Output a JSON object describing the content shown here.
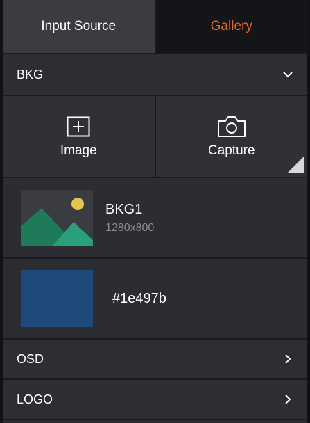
{
  "tabs": {
    "input_source": "Input Source",
    "gallery": "Gallery"
  },
  "colors": {
    "active_tab_text": "#e8651c",
    "swatch": "#1e497b",
    "thumb_bg": "#3a3c42",
    "thumb_hill_dark": "#1f7a5a",
    "thumb_hill_light": "#2aa07a",
    "thumb_sun": "#e6c34a"
  },
  "bkg_section": {
    "label": "BKG",
    "chevron": "chevron-down-icon"
  },
  "actions": {
    "image_label": "Image",
    "image_icon": "add-image-icon",
    "capture_label": "Capture",
    "capture_icon": "camera-icon"
  },
  "items": [
    {
      "name": "BKG1",
      "resolution": "1280x800",
      "icon": "image-thumbnail-icon"
    },
    {
      "hex": "#1e497b"
    }
  ],
  "osd_section": {
    "label": "OSD",
    "chevron": "chevron-right-icon"
  },
  "logo_section": {
    "label": "LOGO",
    "chevron": "chevron-right-icon"
  }
}
